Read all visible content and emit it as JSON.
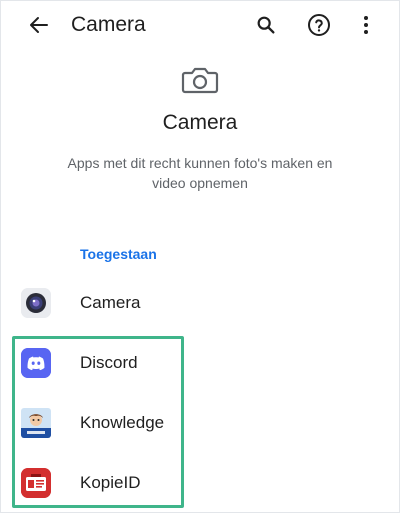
{
  "header": {
    "title": "Camera",
    "icons": [
      "back-arrow-icon",
      "search-icon",
      "help-icon",
      "more-vert-icon"
    ]
  },
  "hero": {
    "icon": "camera-icon",
    "title": "Camera",
    "description": "Apps met dit recht kunnen foto's maken en video opnemen"
  },
  "section": {
    "label": "Toegestaan"
  },
  "apps": [
    {
      "name": "Camera",
      "icon": "camera-app-icon"
    },
    {
      "name": "Discord",
      "icon": "discord-app-icon"
    },
    {
      "name": "Knowledge",
      "icon": "knowledge-app-icon"
    },
    {
      "name": "KopieID",
      "icon": "kopieid-app-icon"
    }
  ],
  "colors": {
    "accent": "#1a73e8",
    "highlight": "#3fb58a",
    "discord": "#5865f2",
    "kopieid": "#d32f2f"
  }
}
